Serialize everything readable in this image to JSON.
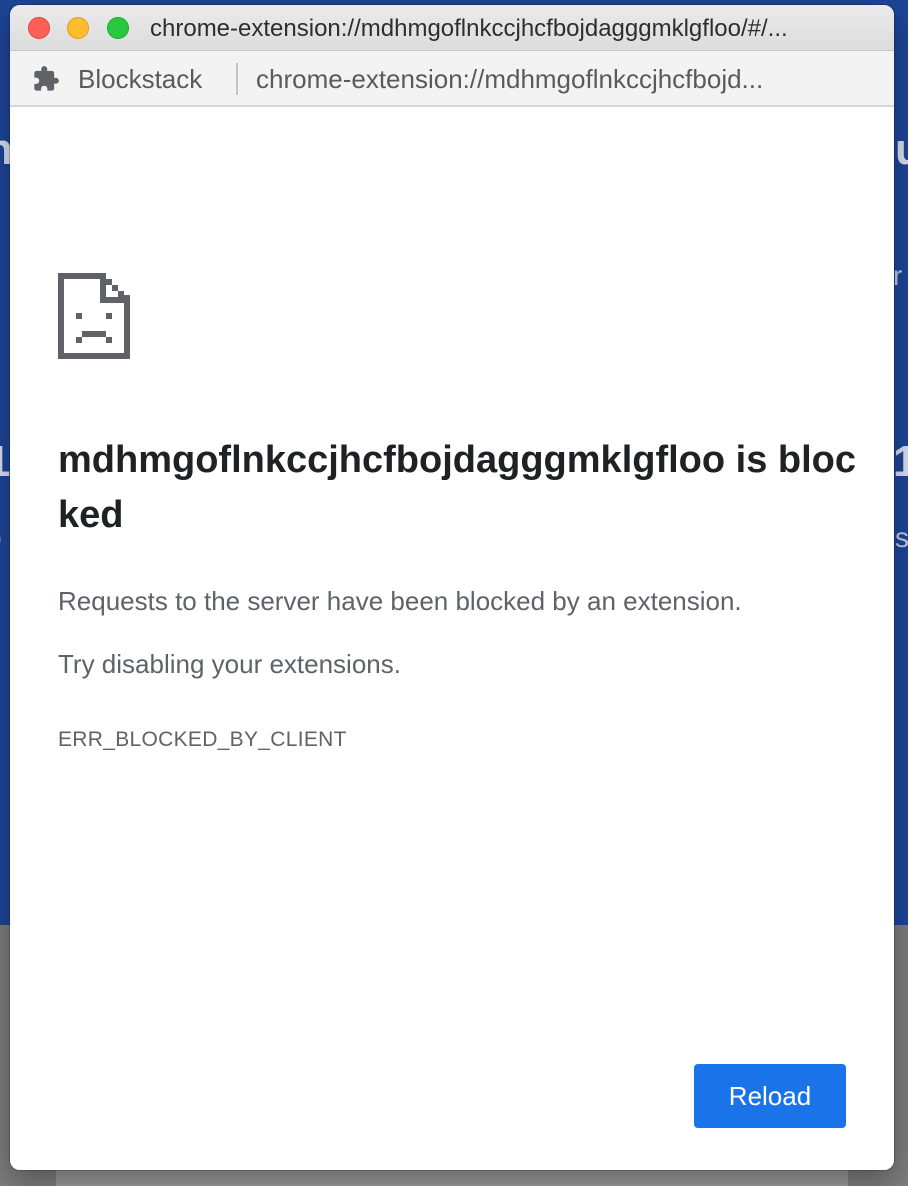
{
  "window": {
    "title": "chrome-extension://mdhmgoflnkccjhcfbojdagggmklgfloo/#/..."
  },
  "address_bar": {
    "extension_name": "Blockstack",
    "url": "chrome-extension://mdhmgoflnkccjhcfbojd..."
  },
  "error": {
    "icon": "sad-document-icon",
    "heading": "mdhmgoflnkccjhcfbojdagggmklgfloo is blocked",
    "message_1": "Requests to the server have been blocked by an extension.",
    "message_2": "Try disabling your extensions.",
    "code": "ERR_BLOCKED_BY_CLIENT",
    "reload_label": "Reload"
  },
  "colors": {
    "reload_button": "#1a73e8",
    "background_page": "#1e4599",
    "close": "#fe5f57",
    "minimize": "#febc2e",
    "maximize": "#28c840"
  }
}
